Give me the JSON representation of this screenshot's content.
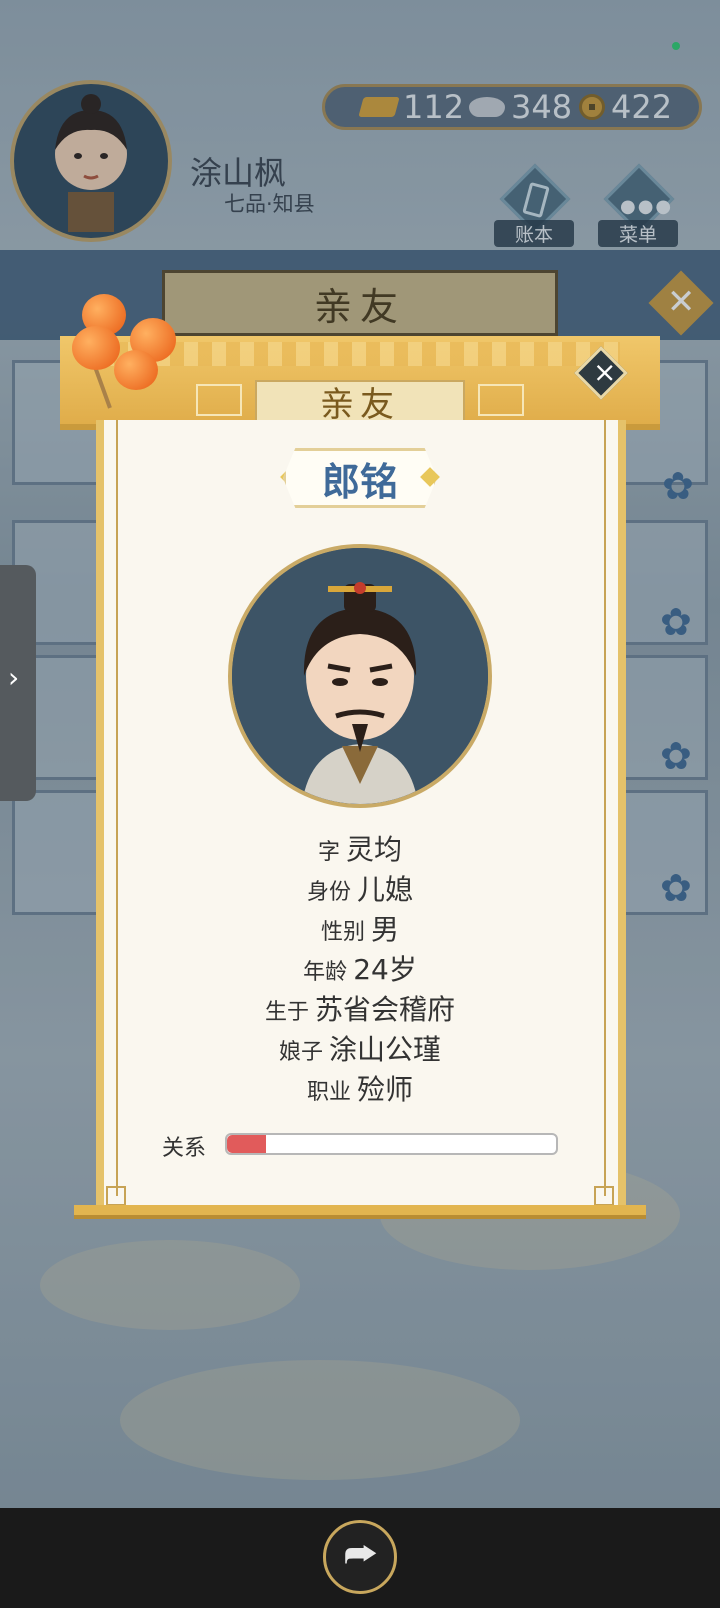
{
  "header": {
    "player_name": "涂山枫",
    "player_rank": "七品·知县",
    "resources": {
      "gold": "112",
      "silver": "348",
      "coin": "422"
    },
    "ledger_label": "账本",
    "menu_label": "菜单"
  },
  "background": {
    "panel_title": "亲友"
  },
  "dialog": {
    "title": "亲友",
    "name": "郎铭",
    "fields": [
      {
        "key": "字",
        "value": "灵均"
      },
      {
        "key": "身份",
        "value": "儿媳"
      },
      {
        "key": "性别",
        "value": "男"
      },
      {
        "key": "年龄",
        "value": "24岁"
      },
      {
        "key": "生于",
        "value": "苏省会稽府"
      },
      {
        "key": "娘子",
        "value": "涂山公瑾"
      },
      {
        "key": "职业",
        "value": "殓师"
      }
    ],
    "relation_label": "关系",
    "relation_level": 0.12,
    "relation_color": "#e15b5b"
  },
  "icons": {
    "close": "close-icon",
    "expand": "chevron-right-icon",
    "share": "share-icon"
  }
}
